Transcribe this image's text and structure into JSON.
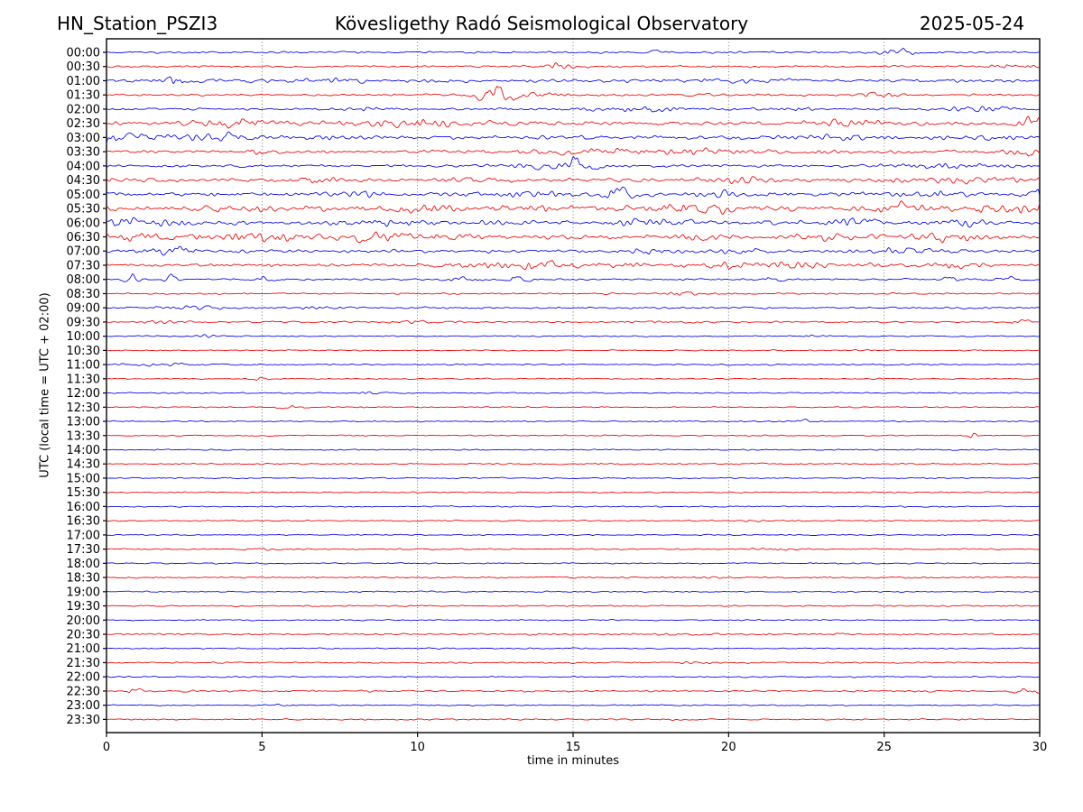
{
  "chart_data": {
    "type": "line",
    "subtype": "helicorder-seismogram",
    "title_left": "HN_Station_PSZI3",
    "title_center": "Kövesligethy Radó Seismological Observatory",
    "title_right": "2025-05-24",
    "xlabel": "time in minutes",
    "ylabel": "UTC (local time = UTC + 02:00)",
    "xlim": [
      0,
      30
    ],
    "x_ticks": [
      0,
      5,
      10,
      15,
      20,
      25,
      30
    ],
    "grid_minutes": [
      5,
      10,
      15,
      20,
      25
    ],
    "grid_style": "dotted",
    "legend": "none",
    "trace_minutes_per_row": 30,
    "colors": {
      "blue": "#0000ee",
      "red": "#ee0000",
      "frame": "#000000",
      "grid": "#666666",
      "text": "#000000",
      "background": "#ffffff"
    },
    "rows": [
      {
        "label": "00:00",
        "color": "blue",
        "base": 0.45,
        "events": [
          [
            17.8,
            0.3,
            0.7
          ],
          [
            25.5,
            0.35,
            1.3
          ]
        ]
      },
      {
        "label": "00:30",
        "color": "red",
        "base": 0.45,
        "events": [
          [
            14.6,
            0.5,
            0.9
          ],
          [
            28.8,
            0.6,
            1.0
          ]
        ]
      },
      {
        "label": "01:00",
        "color": "blue",
        "base": 0.7,
        "events": [
          [
            2.3,
            0.45,
            2.0
          ],
          [
            7.0,
            1.0,
            0.7
          ],
          [
            20.0,
            3.0,
            0.4
          ]
        ]
      },
      {
        "label": "01:30",
        "color": "red",
        "base": 0.5,
        "events": [
          [
            12.45,
            0.28,
            4.2
          ],
          [
            13.3,
            0.9,
            1.1
          ],
          [
            24.8,
            0.5,
            0.9
          ]
        ]
      },
      {
        "label": "02:00",
        "color": "blue",
        "base": 0.5,
        "events": [
          [
            8.8,
            0.5,
            0.9
          ],
          [
            17.3,
            1.2,
            1.5
          ],
          [
            22.4,
            0.4,
            0.7
          ],
          [
            28.0,
            0.8,
            0.9
          ]
        ]
      },
      {
        "label": "02:30",
        "color": "red",
        "base": 0.85,
        "events": [
          [
            4.0,
            1.0,
            1.3
          ],
          [
            9.8,
            1.6,
            1.1
          ],
          [
            23.7,
            0.7,
            1.1
          ],
          [
            29.8,
            0.35,
            2.2
          ]
        ]
      },
      {
        "label": "03:00",
        "color": "blue",
        "base": 0.85,
        "events": [
          [
            0.6,
            0.7,
            1.4
          ],
          [
            3.8,
            0.8,
            1.4
          ],
          [
            7.5,
            0.6,
            0.9
          ],
          [
            23.0,
            0.8,
            1.1
          ],
          [
            28.5,
            0.5,
            0.9
          ]
        ]
      },
      {
        "label": "03:30",
        "color": "red",
        "base": 0.75,
        "events": [
          [
            5.2,
            0.4,
            1.1
          ],
          [
            17.0,
            2.5,
            1.1
          ],
          [
            29.6,
            0.4,
            1.8
          ]
        ]
      },
      {
        "label": "04:00",
        "color": "blue",
        "base": 0.65,
        "events": [
          [
            14.2,
            0.9,
            0.9
          ],
          [
            15.05,
            0.3,
            2.6
          ],
          [
            27.5,
            1.5,
            1.1
          ]
        ]
      },
      {
        "label": "04:30",
        "color": "red",
        "base": 0.85,
        "events": [
          [
            6.8,
            0.5,
            1.1
          ],
          [
            12.0,
            0.8,
            0.9
          ],
          [
            20.5,
            0.6,
            0.9
          ],
          [
            27.5,
            1.5,
            1.2
          ]
        ]
      },
      {
        "label": "05:00",
        "color": "blue",
        "base": 0.85,
        "events": [
          [
            8.2,
            0.5,
            1.2
          ],
          [
            14.0,
            0.8,
            1.1
          ],
          [
            16.45,
            0.3,
            2.8
          ],
          [
            20.0,
            0.6,
            0.9
          ],
          [
            25.8,
            1.2,
            1.2
          ],
          [
            29.9,
            0.3,
            2.0
          ]
        ]
      },
      {
        "label": "05:30",
        "color": "red",
        "base": 1.1,
        "events": [
          [
            4.5,
            0.8,
            0.9
          ],
          [
            10.2,
            0.8,
            1.2
          ],
          [
            13.5,
            0.6,
            1.4
          ],
          [
            19.0,
            1.2,
            1.6
          ],
          [
            25.5,
            0.6,
            1.4
          ],
          [
            29.0,
            1.0,
            1.5
          ]
        ]
      },
      {
        "label": "06:00",
        "color": "blue",
        "base": 0.95,
        "events": [
          [
            0.5,
            0.5,
            1.5
          ],
          [
            2.0,
            0.5,
            1.1
          ],
          [
            9.2,
            0.7,
            1.2
          ],
          [
            17.5,
            0.8,
            1.3
          ],
          [
            24.0,
            0.6,
            1.0
          ],
          [
            27.5,
            0.6,
            1.1
          ]
        ]
      },
      {
        "label": "06:30",
        "color": "red",
        "base": 0.95,
        "events": [
          [
            1.5,
            1.0,
            1.4
          ],
          [
            4.5,
            1.2,
            1.4
          ],
          [
            8.8,
            1.0,
            1.5
          ],
          [
            11.0,
            0.5,
            1.1
          ],
          [
            19.0,
            0.7,
            1.0
          ],
          [
            22.5,
            0.6,
            1.1
          ],
          [
            27.0,
            0.8,
            1.1
          ]
        ]
      },
      {
        "label": "07:00",
        "color": "blue",
        "base": 0.75,
        "events": [
          [
            2.0,
            0.6,
            1.1
          ],
          [
            17.0,
            0.7,
            0.9
          ],
          [
            20.4,
            0.5,
            1.3
          ],
          [
            25.5,
            0.8,
            1.0
          ]
        ]
      },
      {
        "label": "07:30",
        "color": "red",
        "base": 0.75,
        "events": [
          [
            13.5,
            1.8,
            1.2
          ],
          [
            21.0,
            1.8,
            1.2
          ],
          [
            27.0,
            0.7,
            1.0
          ]
        ]
      },
      {
        "label": "08:00",
        "color": "blue",
        "base": 0.4,
        "events": [
          [
            0.8,
            0.13,
            1.7
          ],
          [
            2.1,
            0.13,
            1.9
          ],
          [
            5.0,
            0.18,
            1.4
          ],
          [
            11.5,
            0.3,
            0.9
          ],
          [
            13.2,
            0.2,
            1.1
          ],
          [
            21.3,
            0.22,
            1.2
          ],
          [
            27.0,
            0.2,
            0.9
          ],
          [
            29.0,
            0.3,
            0.9
          ]
        ]
      },
      {
        "label": "08:30",
        "color": "red",
        "base": 0.35,
        "events": [
          [
            18.8,
            0.4,
            1.5
          ]
        ]
      },
      {
        "label": "09:00",
        "color": "blue",
        "base": 0.4,
        "events": [
          [
            2.5,
            1.0,
            0.6
          ],
          [
            7.0,
            0.8,
            0.45
          ]
        ]
      },
      {
        "label": "09:30",
        "color": "red",
        "base": 0.35,
        "events": [
          [
            1.5,
            0.5,
            0.55
          ],
          [
            10.0,
            0.6,
            0.4
          ],
          [
            18.5,
            0.5,
            0.45
          ],
          [
            29.5,
            0.3,
            0.55
          ]
        ]
      },
      {
        "label": "10:00",
        "color": "blue",
        "base": 0.28,
        "events": [
          [
            3.3,
            0.4,
            0.55
          ],
          [
            22.8,
            0.5,
            0.45
          ]
        ]
      },
      {
        "label": "10:30",
        "color": "red",
        "base": 0.28,
        "events": []
      },
      {
        "label": "11:00",
        "color": "blue",
        "base": 0.32,
        "events": [
          [
            2.0,
            0.8,
            0.55
          ]
        ]
      },
      {
        "label": "11:30",
        "color": "red",
        "base": 0.28,
        "events": [
          [
            5.0,
            0.15,
            0.7
          ]
        ]
      },
      {
        "label": "12:00",
        "color": "blue",
        "base": 0.28,
        "events": [
          [
            8.5,
            0.4,
            0.45
          ]
        ]
      },
      {
        "label": "12:30",
        "color": "red",
        "base": 0.28,
        "events": [
          [
            6.0,
            0.3,
            0.45
          ]
        ]
      },
      {
        "label": "13:00",
        "color": "blue",
        "base": 0.28,
        "events": [
          [
            22.5,
            0.4,
            0.45
          ]
        ]
      },
      {
        "label": "13:30",
        "color": "red",
        "base": 0.28,
        "events": [
          [
            27.9,
            0.07,
            1.5
          ]
        ]
      },
      {
        "label": "14:00",
        "color": "blue",
        "base": 0.28,
        "events": []
      },
      {
        "label": "14:30",
        "color": "red",
        "base": 0.32,
        "events": []
      },
      {
        "label": "15:00",
        "color": "blue",
        "base": 0.28,
        "events": []
      },
      {
        "label": "15:30",
        "color": "red",
        "base": 0.28,
        "events": []
      },
      {
        "label": "16:00",
        "color": "blue",
        "base": 0.28,
        "events": []
      },
      {
        "label": "16:30",
        "color": "red",
        "base": 0.32,
        "events": [
          [
            20.5,
            0.5,
            0.45
          ]
        ]
      },
      {
        "label": "17:00",
        "color": "blue",
        "base": 0.28,
        "events": []
      },
      {
        "label": "17:30",
        "color": "red",
        "base": 0.32,
        "events": [
          [
            5.0,
            0.3,
            0.45
          ],
          [
            21.5,
            0.6,
            0.45
          ]
        ]
      },
      {
        "label": "18:00",
        "color": "blue",
        "base": 0.28,
        "events": []
      },
      {
        "label": "18:30",
        "color": "red",
        "base": 0.38,
        "events": []
      },
      {
        "label": "19:00",
        "color": "blue",
        "base": 0.28,
        "events": []
      },
      {
        "label": "19:30",
        "color": "red",
        "base": 0.32,
        "events": []
      },
      {
        "label": "20:00",
        "color": "blue",
        "base": 0.28,
        "events": []
      },
      {
        "label": "20:30",
        "color": "red",
        "base": 0.42,
        "events": []
      },
      {
        "label": "21:00",
        "color": "blue",
        "base": 0.28,
        "events": []
      },
      {
        "label": "21:30",
        "color": "red",
        "base": 0.32,
        "events": [
          [
            19.0,
            0.4,
            0.4
          ]
        ]
      },
      {
        "label": "22:00",
        "color": "blue",
        "base": 0.28,
        "events": []
      },
      {
        "label": "22:30",
        "color": "red",
        "base": 0.42,
        "events": [
          [
            1.0,
            0.2,
            0.7
          ],
          [
            29.7,
            0.3,
            0.9
          ]
        ]
      },
      {
        "label": "23:00",
        "color": "blue",
        "base": 0.28,
        "events": [
          [
            5.3,
            0.3,
            0.45
          ]
        ]
      },
      {
        "label": "23:30",
        "color": "red",
        "base": 0.32,
        "events": []
      }
    ]
  }
}
